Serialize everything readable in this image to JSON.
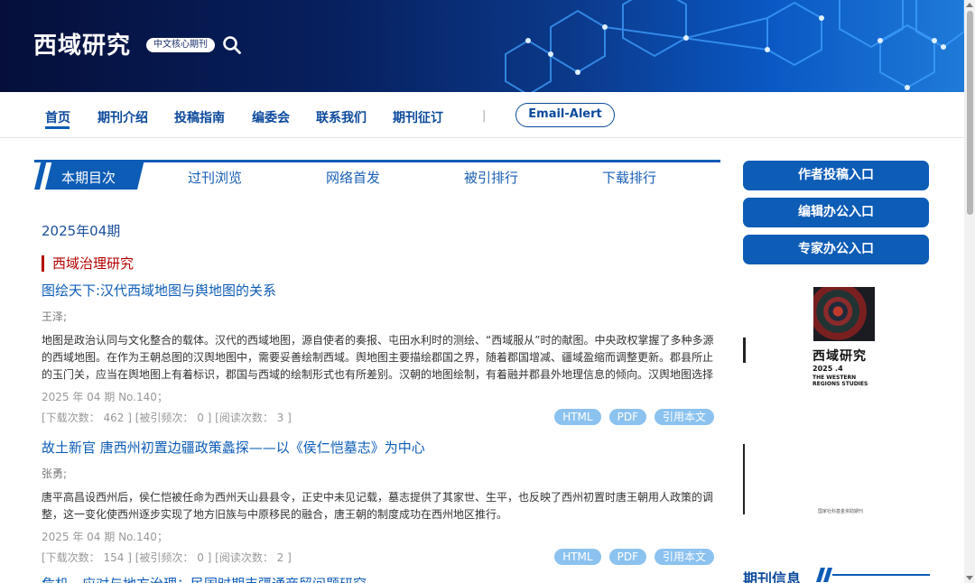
{
  "header": {
    "site_title": "西域研究",
    "badge": "中文核心期刊",
    "icon": "search-icon"
  },
  "nav": {
    "items": [
      "首页",
      "期刊介绍",
      "投稿指南",
      "编委会",
      "联系我们",
      "期刊征订"
    ],
    "separator": "|",
    "email_alert": "Email-Alert"
  },
  "tabs": [
    "本期目次",
    "过刊浏览",
    "网络首发",
    "被引排行",
    "下载排行"
  ],
  "main": {
    "issue": "2025年04期",
    "section": "西域治理研究",
    "articles": [
      {
        "title": "图绘天下:汉代西域地图与舆地图的关系",
        "author": "王泽;",
        "abstract": "地图是政治认同与文化整合的载体。汉代的西域地图，源自使者的奏报、屯田水利时的测绘、“西域服从”时的献图。中央政权掌握了多种多源的西域地图。在作为王朝总图的汉舆地图中，需要妥善绘制西域。舆地图主要描绘郡国之界，随着郡国增减、疆域盈缩而调整更新。郡县所止的玉门关，应当在舆地图上有着标识，郡国与西域的绘制形式也有所差别。汉朝的地图绘制，有着融并郡县外地理信息的倾向。汉舆地图选择性地绘入...",
        "issue_line": "2025 年 04 期 No.140；",
        "stats": "[下载次数： 462 ] [被引频次： 0 ] [阅读次数： 3 ]",
        "buttons": [
          "HTML",
          "PDF",
          "引用本文"
        ]
      },
      {
        "title": "故土新官 唐西州初置边疆政策蠡探——以《侯仁恺墓志》为中心",
        "author": "张勇;",
        "abstract": "唐平高昌设西州后，侯仁恺被任命为西州天山县县令，正史中未见记载，墓志提供了其家世、生平，也反映了西州初置时唐王朝用人政策的调整，这一变化使西州逐步实现了地方旧族与中原移民的融合，唐王朝的制度成功在西州地区推行。",
        "issue_line": "2025 年 04 期 No.140；",
        "stats": "[下载次数： 154 ] [被引频次： 0 ] [阅读次数： 2 ]",
        "buttons": [
          "HTML",
          "PDF",
          "引用本文"
        ]
      },
      {
        "title": "危机、应对与地方治理：民国时期丰疆通商贸问题研究"
      }
    ]
  },
  "sidebar": {
    "entries": [
      "作者投稿入口",
      "编辑办公入口",
      "专家办公入口"
    ],
    "cover": {
      "title": "西域研究",
      "number": "2025 .4",
      "english": "THE WESTERN REGIONS STUDIES",
      "footer": "国家社科基金资助期刊"
    },
    "info_heading": "期刊信息"
  },
  "colors": {
    "primary": "#0d5cb6",
    "nav_text": "#0d4a9c",
    "section_red": "#b30000",
    "pill": "#8bc2ef"
  }
}
